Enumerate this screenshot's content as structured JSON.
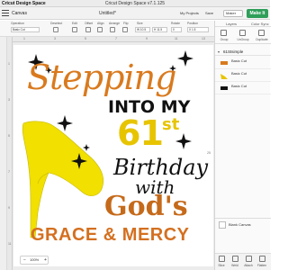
{
  "app": {
    "name": "Cricut Design Space",
    "window_title": "Cricut Design Space  v7.1.125"
  },
  "header": {
    "canvas_label": "Canvas",
    "project_title": "Untitled*",
    "my_projects": "My Projects",
    "save": "Save",
    "machine": "Maker",
    "make_button": "Make It"
  },
  "toolbar": {
    "labels": [
      "Operation",
      "Deselect",
      "Edit",
      "Offset",
      "Align",
      "Arrange",
      "Flip",
      "Size",
      "Rotate",
      "Position"
    ],
    "operation_value": "Basic Cut",
    "size_w_value": "W 10.5",
    "size_h_value": "H 11.5",
    "rotate_value": "0",
    "position_value": "X 1.5"
  },
  "rulers": {
    "top": [
      "1",
      "3",
      "5",
      "7",
      "9",
      "11",
      "13"
    ],
    "left": [
      "1",
      "3",
      "5",
      "7",
      "9",
      "11"
    ],
    "marker": "25"
  },
  "design": {
    "line1": "Stepping",
    "line2": "INTO MY",
    "line3_num": "61",
    "line3_suffix": "st",
    "line4": "Birthday",
    "line5": "with",
    "line6": "God's",
    "line7": "GRACE & MERCY",
    "colors": {
      "orange": "#d97a1e",
      "yellow": "#e7c400",
      "black": "#111111",
      "dark_orange": "#c56a1a"
    }
  },
  "zoom": {
    "minus": "−",
    "value": "100%",
    "plus": "+"
  },
  "panel": {
    "tabs": [
      "Layers",
      "Color Sync"
    ],
    "tools": [
      "Group",
      "UnGroup",
      "Duplicate"
    ],
    "group_name": "61Stsimple",
    "layers": [
      {
        "name": "Basic Cut",
        "type": "",
        "color": "#d97a1e"
      },
      {
        "name": "Basic Cut",
        "type": "",
        "color": "#e7c400"
      },
      {
        "name": "Basic Cut",
        "type": "",
        "color": "#111111"
      }
    ],
    "blank_canvas": "Blank Canvas",
    "bottom_actions": [
      "Slice",
      "Weld",
      "Attach",
      "Flatten"
    ]
  }
}
